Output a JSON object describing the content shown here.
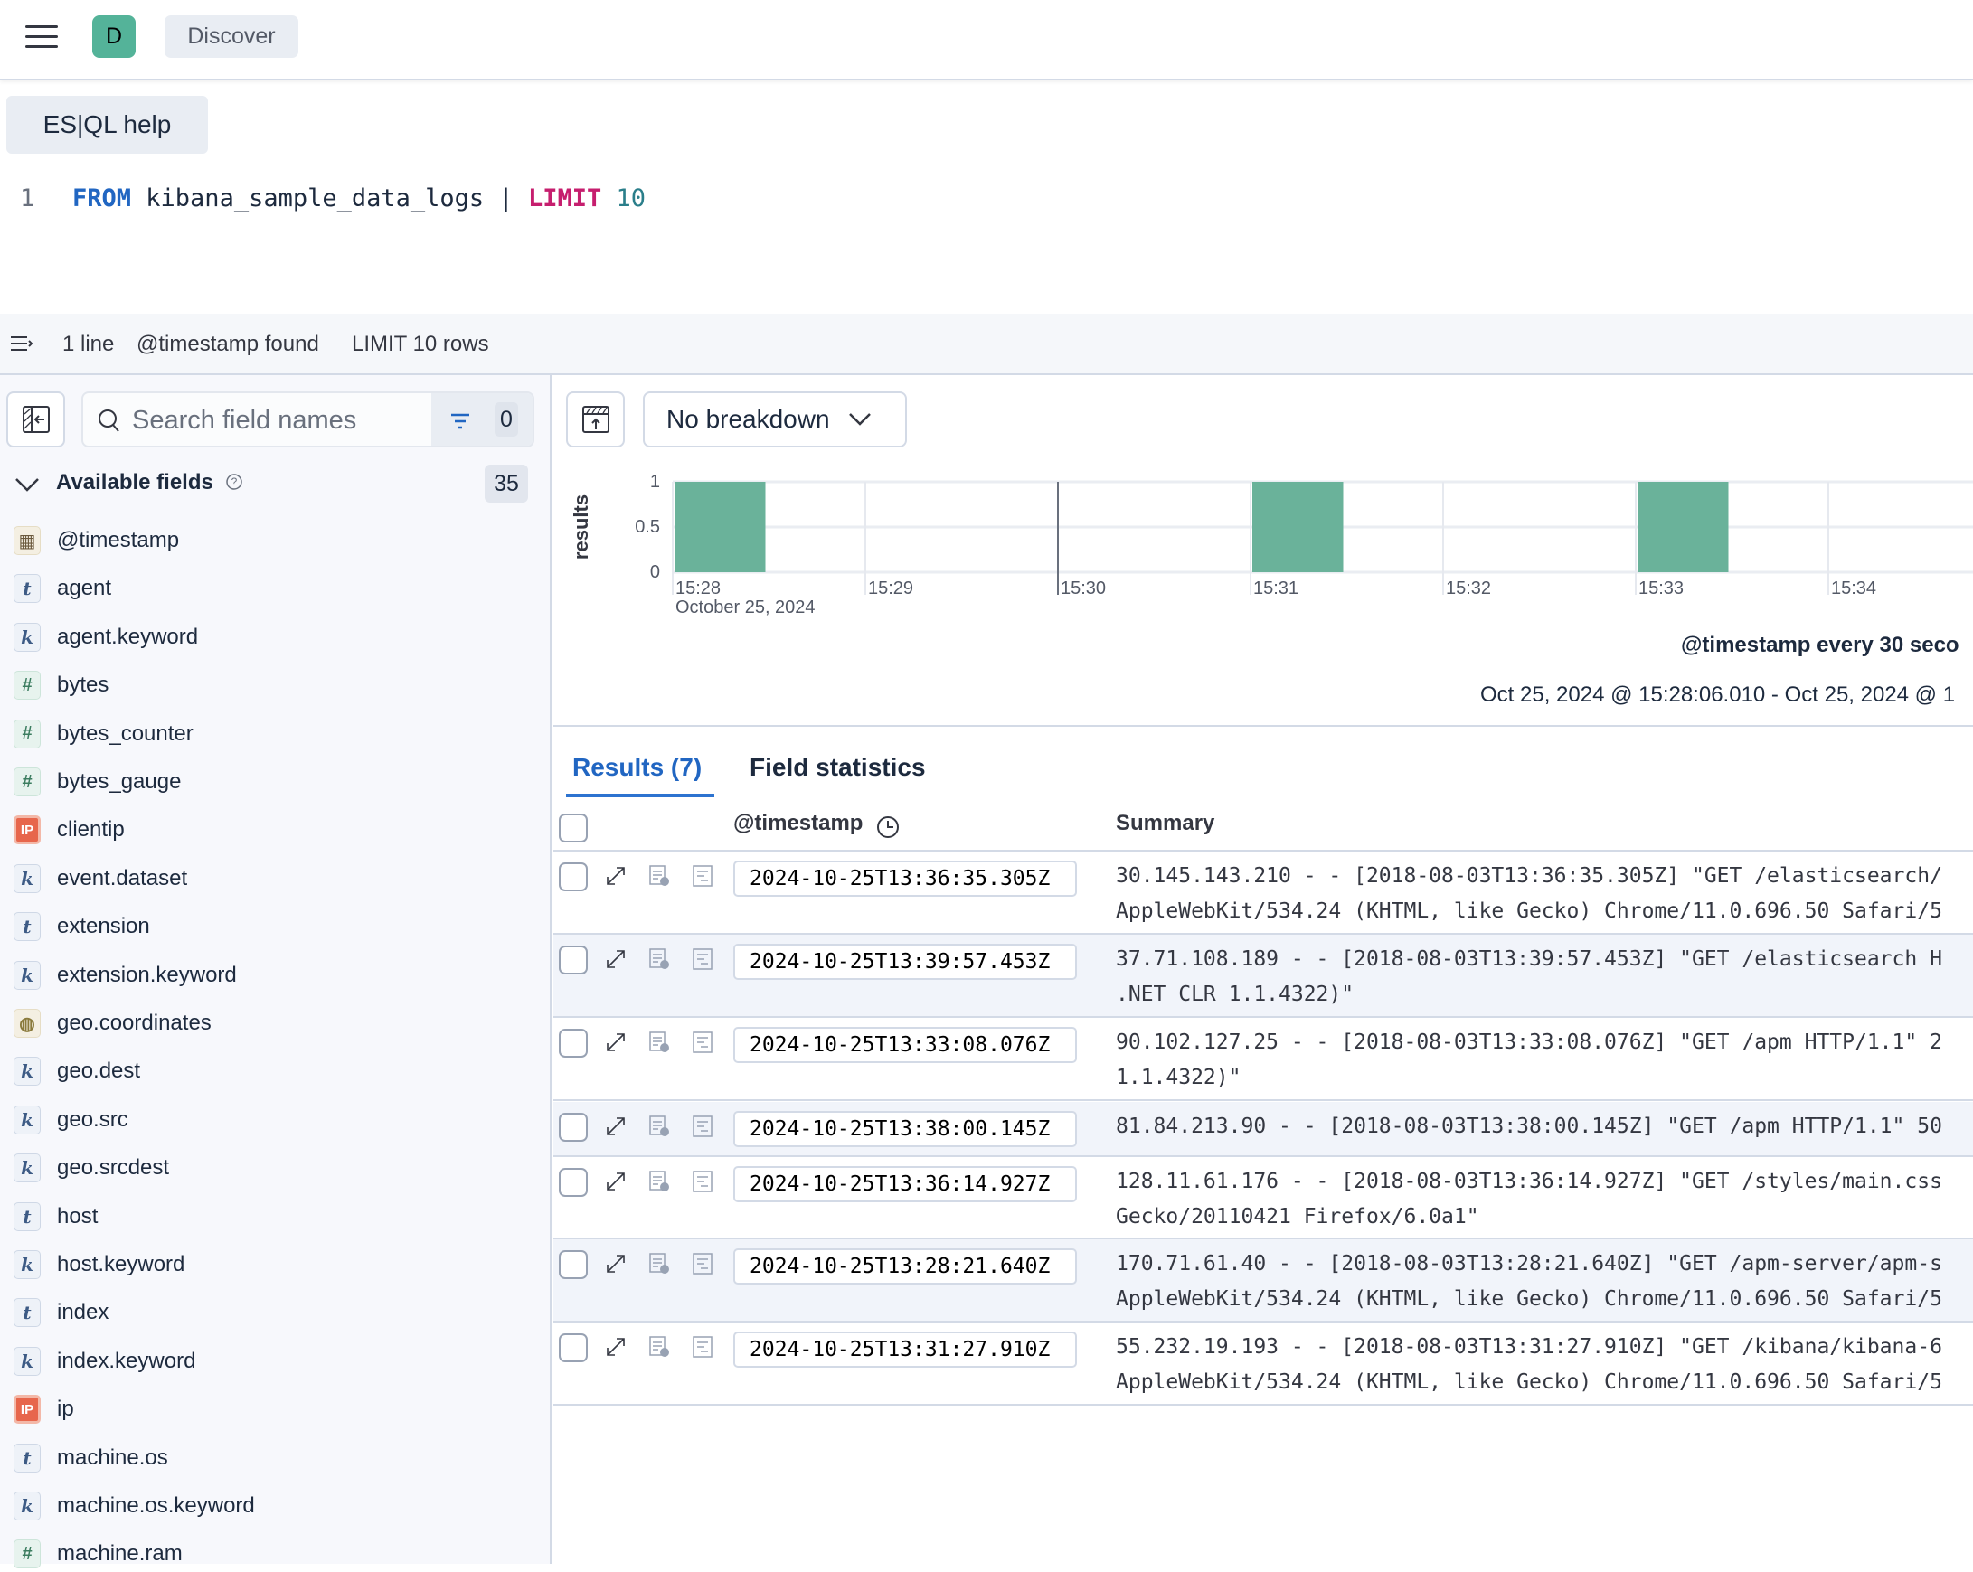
{
  "header": {
    "avatar_letter": "D",
    "breadcrumb": "Discover",
    "menu_icon": "hamburger-icon"
  },
  "editor": {
    "help_label": "ES|QL help",
    "line_number": "1",
    "tokens": {
      "from": "FROM",
      "index": " kibana_sample_data_logs | ",
      "limit": "LIMIT",
      "value": " 10"
    }
  },
  "status": {
    "lines": "1 line",
    "timestamp": "@timestamp found",
    "limit": "LIMIT 10 rows"
  },
  "sidebar": {
    "search_placeholder": "Search field names",
    "filter_count": "0",
    "available_label": "Available fields",
    "available_count": "35",
    "fields": [
      {
        "name": "@timestamp",
        "type": "date"
      },
      {
        "name": "agent",
        "type": "t"
      },
      {
        "name": "agent.keyword",
        "type": "k"
      },
      {
        "name": "bytes",
        "type": "#"
      },
      {
        "name": "bytes_counter",
        "type": "#"
      },
      {
        "name": "bytes_gauge",
        "type": "#"
      },
      {
        "name": "clientip",
        "type": "ip"
      },
      {
        "name": "event.dataset",
        "type": "k"
      },
      {
        "name": "extension",
        "type": "t"
      },
      {
        "name": "extension.keyword",
        "type": "k"
      },
      {
        "name": "geo.coordinates",
        "type": "geo"
      },
      {
        "name": "geo.dest",
        "type": "k"
      },
      {
        "name": "geo.src",
        "type": "k"
      },
      {
        "name": "geo.srcdest",
        "type": "k"
      },
      {
        "name": "host",
        "type": "t"
      },
      {
        "name": "host.keyword",
        "type": "k"
      },
      {
        "name": "index",
        "type": "t"
      },
      {
        "name": "index.keyword",
        "type": "k"
      },
      {
        "name": "ip",
        "type": "ip"
      },
      {
        "name": "machine.os",
        "type": "t"
      },
      {
        "name": "machine.os.keyword",
        "type": "k"
      },
      {
        "name": "machine.ram",
        "type": "#"
      }
    ]
  },
  "toolbar": {
    "breakdown_label": "No breakdown"
  },
  "chart_data": {
    "type": "bar",
    "ylabel": "results",
    "xlabel": "@timestamp every 30 seco",
    "ylim": [
      0,
      1
    ],
    "yticks": [
      "1",
      "0.5",
      "0"
    ],
    "xticks": [
      "15:28",
      "15:29",
      "15:30",
      "15:31",
      "15:32",
      "15:33",
      "15:34"
    ],
    "xsub": "October 25, 2024",
    "bars": [
      {
        "x": "15:28:00",
        "value": 1
      },
      {
        "x": "15:31:00",
        "value": 1
      },
      {
        "x": "15:33:00",
        "value": 1
      }
    ],
    "marker": "15:30",
    "bar_color": "#6ab29a",
    "range": "Oct 25, 2024 @ 15:28:06.010 - Oct 25, 2024 @ 1"
  },
  "tabs": [
    {
      "label": "Results (7)",
      "active": true
    },
    {
      "label": "Field statistics",
      "active": false
    }
  ],
  "table": {
    "headers": {
      "timestamp": "@timestamp",
      "summary": "Summary"
    },
    "rows": [
      {
        "ts": "2024-10-25T13:36:35.305Z",
        "summary": "30.145.143.210 - - [2018-08-03T13:36:35.305Z] \"GET /elasticsearch/\nAppleWebKit/534.24 (KHTML, like Gecko) Chrome/11.0.696.50 Safari/5"
      },
      {
        "ts": "2024-10-25T13:39:57.453Z",
        "summary": "37.71.108.189 - - [2018-08-03T13:39:57.453Z] \"GET /elasticsearch H\n.NET CLR 1.1.4322)\""
      },
      {
        "ts": "2024-10-25T13:33:08.076Z",
        "summary": "90.102.127.25 - - [2018-08-03T13:33:08.076Z] \"GET /apm HTTP/1.1\" 2\n1.1.4322)\""
      },
      {
        "ts": "2024-10-25T13:38:00.145Z",
        "summary": "81.84.213.90 - - [2018-08-03T13:38:00.145Z] \"GET /apm HTTP/1.1\" 50"
      },
      {
        "ts": "2024-10-25T13:36:14.927Z",
        "summary": "128.11.61.176 - - [2018-08-03T13:36:14.927Z] \"GET /styles/main.css\nGecko/20110421 Firefox/6.0a1\""
      },
      {
        "ts": "2024-10-25T13:28:21.640Z",
        "summary": "170.71.61.40 - - [2018-08-03T13:28:21.640Z] \"GET /apm-server/apm-s\nAppleWebKit/534.24 (KHTML, like Gecko) Chrome/11.0.696.50 Safari/5"
      },
      {
        "ts": "2024-10-25T13:31:27.910Z",
        "summary": "55.232.19.193 - - [2018-08-03T13:31:27.910Z] \"GET /kibana/kibana-6\nAppleWebKit/534.24 (KHTML, like Gecko) Chrome/11.0.696.50 Safari/5"
      }
    ]
  }
}
